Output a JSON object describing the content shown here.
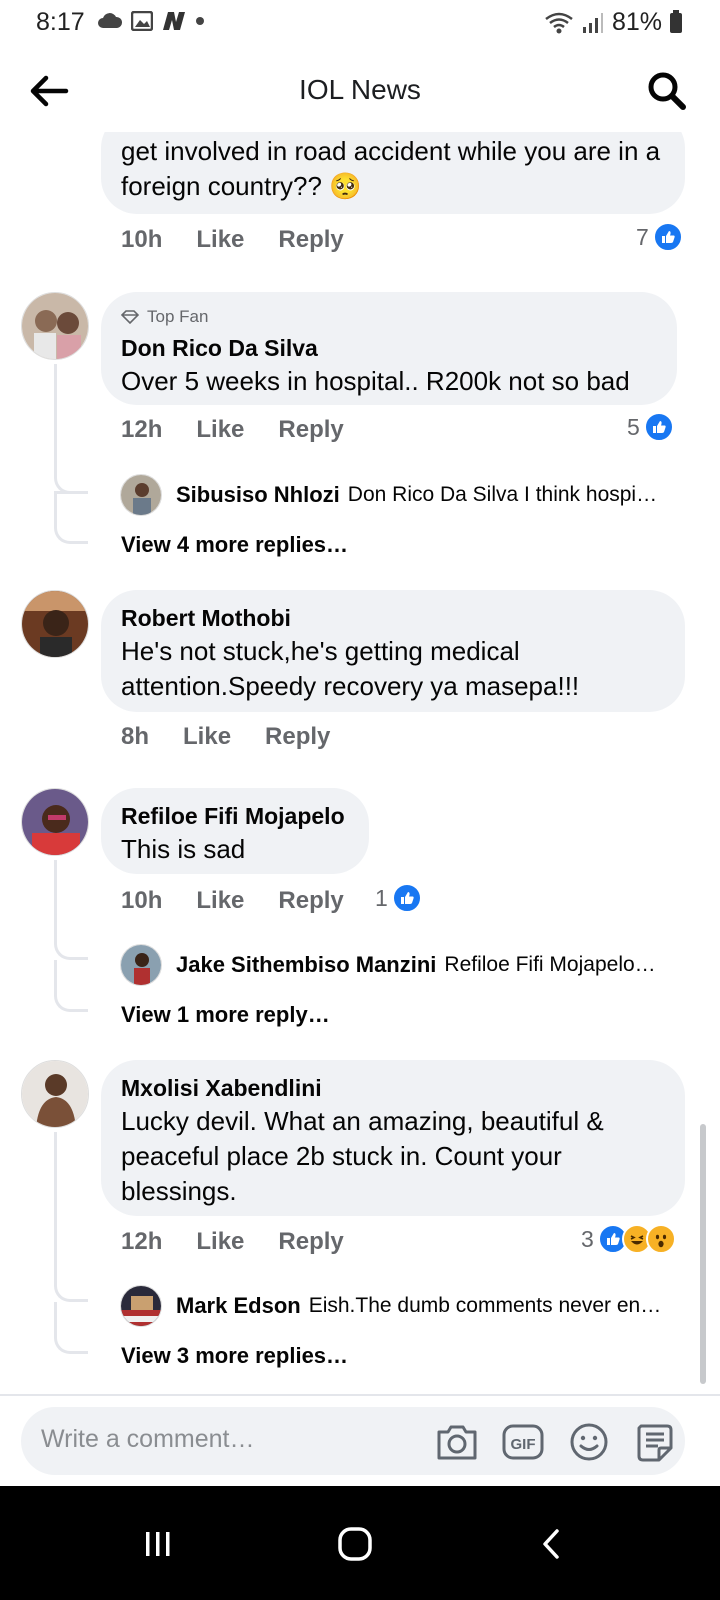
{
  "status": {
    "time": "8:17",
    "battery": "81%"
  },
  "header": {
    "title": "IOL News"
  },
  "comments": [
    {
      "text": "get involved in road accident while you are in a foreign country?? 🥺",
      "time": "10h",
      "like": "Like",
      "reply": "Reply",
      "reactions": "7"
    },
    {
      "badge": "Top Fan",
      "name": "Don Rico Da Silva",
      "text": "Over 5 weeks in hospital.. R200k not so bad",
      "time": "12h",
      "like": "Like",
      "reply": "Reply",
      "reactions": "5",
      "reply_preview": {
        "name": "Sibusiso Nhlozi",
        "text": "Don Rico Da Silva I think hospi…"
      },
      "more_replies": "View 4 more replies…"
    },
    {
      "name": "Robert Mothobi",
      "text": "He's not stuck,he's  getting medical attention.Speedy recovery ya masepa!!!",
      "time": "8h",
      "like": "Like",
      "reply": "Reply"
    },
    {
      "name": "Refiloe Fifi Mojapelo",
      "text": "This is sad",
      "time": "10h",
      "like": "Like",
      "reply": "Reply",
      "reactions": "1",
      "reply_preview": {
        "name": "Jake Sithembiso Manzini",
        "text": "Refiloe Fifi Mojapelo…"
      },
      "more_replies": "View 1 more reply…"
    },
    {
      "name": "Mxolisi Xabendlini",
      "text": "Lucky devil. What an amazing, beautiful & peaceful place 2b stuck in. Count your blessings.",
      "time": "12h",
      "like": "Like",
      "reply": "Reply",
      "reactions": "3",
      "reply_preview": {
        "name": "Mark Edson",
        "text": "Eish.The dumb comments never en…"
      },
      "more_replies": "View 3 more replies…"
    }
  ],
  "composer": {
    "placeholder": "Write a comment…"
  },
  "colors": {
    "accent": "#1877f2",
    "bubble": "#f0f2f5",
    "meta": "#65676b"
  },
  "icons": [
    "back-arrow-icon",
    "search-icon",
    "thumbs-up-icon",
    "laugh-emoji-icon",
    "wow-emoji-icon",
    "camera-icon",
    "gif-icon",
    "smiley-icon",
    "sticker-icon"
  ]
}
